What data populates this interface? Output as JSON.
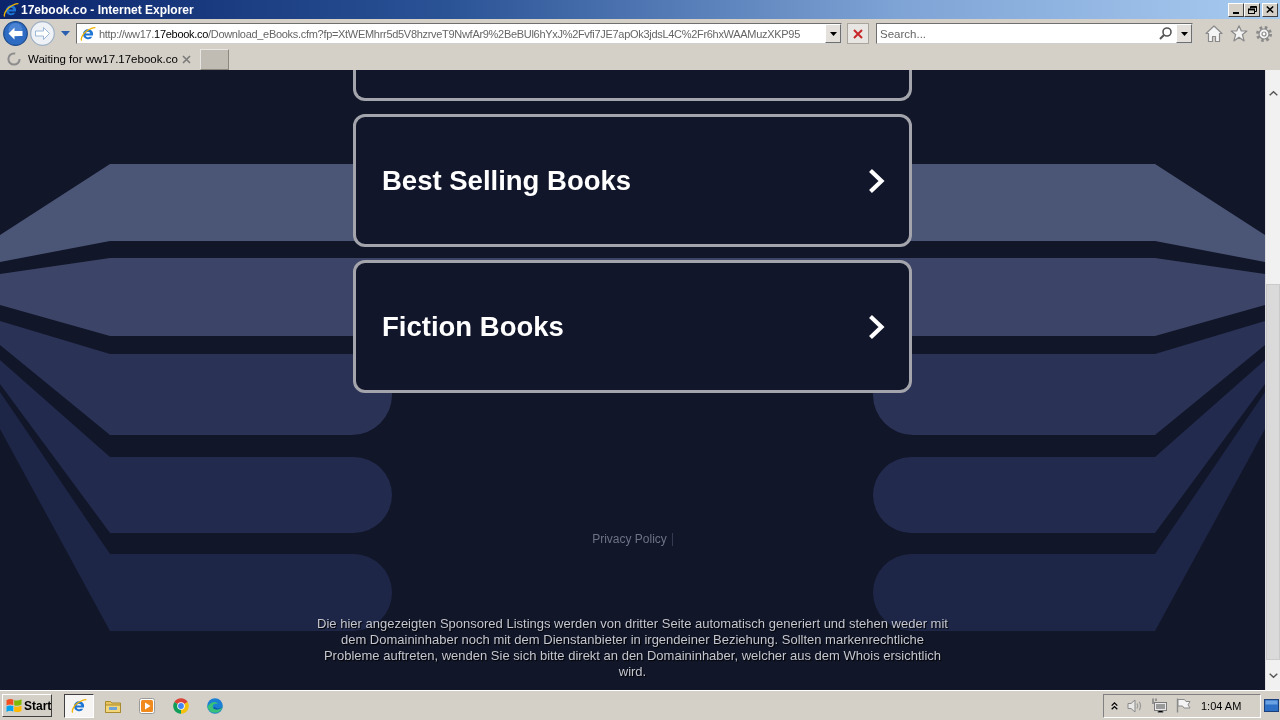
{
  "window": {
    "title": "17ebook.co - Internet Explorer"
  },
  "navigation": [
    {
      "kind": "back",
      "disabled": false
    },
    {
      "kind": "forward",
      "disabled": true
    }
  ],
  "address_bar": {
    "url": [
      {
        "text": "http://ww17.",
        "highlighted": false
      },
      {
        "text": "17ebook.co",
        "highlighted": true
      },
      {
        "text": "/Download_eBooks.cfm?fp=XtWEMhrr5d5V8hzrveT9NwfAr9%2BeBUl6hYxJ%2Fvfi7JE7apOk3jdsL4C%2Fr6hxWAAMuzXKP95",
        "highlighted": false
      }
    ]
  },
  "search": {
    "placeholder": "Search..."
  },
  "tabs": [
    {
      "label": "Waiting for ww17.17ebook.co",
      "selected": true,
      "loading": true
    }
  ],
  "page": {
    "links": [
      {
        "kind": "cut_off"
      },
      {
        "kind": "full",
        "label": "Best Selling Books"
      },
      {
        "kind": "full",
        "label": "Fiction Books"
      }
    ],
    "privacy_link": "Privacy Policy",
    "disclaimer": "Die hier angezeigten Sponsored Listings werden von dritter Seite automatisch generiert und stehen weder mit dem Domaininhaber noch mit dem Dienstanbieter in irgendeiner Beziehung. Sollten markenrechtliche Probleme auftreten, wenden Sie sich bitte direkt an den Domaininhaber, welcher aus dem Whois ersichtlich wird."
  },
  "taskbar": {
    "start": "Start",
    "apps": [
      {
        "kind": "ie",
        "active": true
      },
      {
        "kind": "folder",
        "active": false
      },
      {
        "kind": "media",
        "active": false
      },
      {
        "kind": "chrome",
        "active": false
      },
      {
        "kind": "edge",
        "active": false
      }
    ],
    "clock": "1:04 AM"
  }
}
